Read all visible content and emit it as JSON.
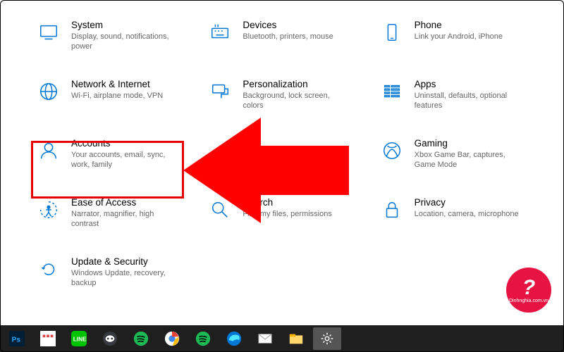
{
  "categories": [
    {
      "id": "system",
      "title": "System",
      "desc": "Display, sound, notifications, power"
    },
    {
      "id": "devices",
      "title": "Devices",
      "desc": "Bluetooth, printers, mouse"
    },
    {
      "id": "phone",
      "title": "Phone",
      "desc": "Link your Android, iPhone"
    },
    {
      "id": "network",
      "title": "Network & Internet",
      "desc": "Wi-Fi, airplane mode, VPN"
    },
    {
      "id": "personalization",
      "title": "Personalization",
      "desc": "Background, lock screen, colors"
    },
    {
      "id": "apps",
      "title": "Apps",
      "desc": "Uninstall, defaults, optional features"
    },
    {
      "id": "accounts",
      "title": "Accounts",
      "desc": "Your accounts, email, sync, work, family"
    },
    {
      "id": "blank",
      "title": "",
      "desc": ""
    },
    {
      "id": "gaming",
      "title": "Gaming",
      "desc": "Xbox Game Bar, captures, Game Mode"
    },
    {
      "id": "ease",
      "title": "Ease of Access",
      "desc": "Narrator, magnifier, high contrast"
    },
    {
      "id": "search",
      "title": "Search",
      "desc": "Find my files, permissions"
    },
    {
      "id": "privacy",
      "title": "Privacy",
      "desc": "Location, camera, microphone"
    },
    {
      "id": "update",
      "title": "Update & Security",
      "desc": "Windows Update, recovery, backup"
    }
  ],
  "watermark": {
    "symbol": "?",
    "text": "Dinhnghia.com.vn"
  },
  "taskbar": {
    "items": [
      "photoshop",
      "text",
      "line",
      "discord",
      "spotify",
      "chrome",
      "spotify2",
      "edge",
      "email",
      "explorer",
      "settings"
    ]
  },
  "accent": "#0078d4",
  "annotation_arrow_color": "#ff0000"
}
